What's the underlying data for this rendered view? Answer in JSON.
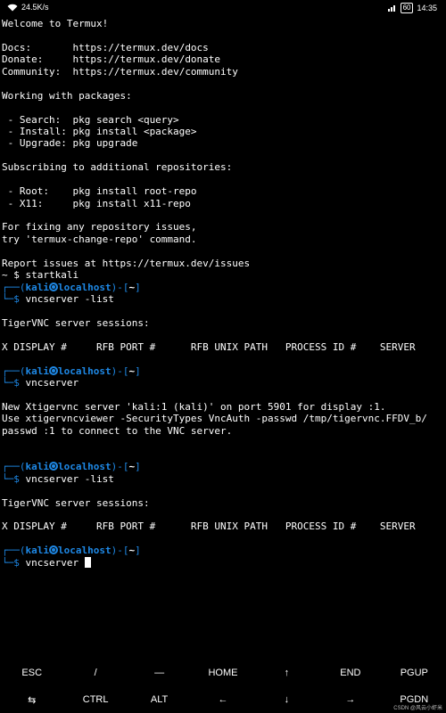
{
  "status_bar": {
    "speed": "24.5K/s",
    "battery": "60",
    "time": "14:35"
  },
  "terminal": {
    "welcome": "Welcome to Termux!",
    "docs_label": "Docs:",
    "docs_url": "https://termux.dev/docs",
    "donate_label": "Donate:",
    "donate_url": "https://termux.dev/donate",
    "community_label": "Community:",
    "community_url": "https://termux.dev/community",
    "packages_heading": "Working with packages:",
    "pkg_search": " - Search:  pkg search <query>",
    "pkg_install": " - Install: pkg install <package>",
    "pkg_upgrade": " - Upgrade: pkg upgrade",
    "repos_heading": "Subscribing to additional repositories:",
    "repo_root": " - Root:    pkg install root-repo",
    "repo_x11": " - X11:     pkg install x11-repo",
    "fix_repo_1": "For fixing any repository issues,",
    "fix_repo_2": "try 'termux-change-repo' command.",
    "report": "Report issues at https://termux.dev/issues",
    "startkali_cmd": "~ $ startkali",
    "prompt_top_start": "┌──(",
    "prompt_user": "kali",
    "prompt_host": "localhost",
    "prompt_close": ")-[",
    "prompt_path": "~",
    "prompt_end": "]",
    "prompt_bottom": "└─$ ",
    "cmd_list": "vncserver -list",
    "cmd_vnc": "vncserver",
    "sessions_heading": "TigerVNC server sessions:",
    "table_header": "X DISPLAY #     RFB PORT #      RFB UNIX PATH   PROCESS ID #    SERVER",
    "new_server": "New Xtigervnc server 'kali:1 (kali)' on port 5901 for display :1.",
    "use_viewer": "Use xtigervncviewer -SecurityTypes VncAuth -passwd /tmp/tigervnc.FFDV_b/",
    "passwd_line": "passwd :1 to connect to the VNC server."
  },
  "extra_keys": {
    "row1": [
      "ESC",
      "/",
      "—",
      "HOME",
      "↑",
      "END",
      "PGUP"
    ],
    "row2": [
      "⇆",
      "CTRL",
      "ALT",
      "←",
      "↓",
      "→",
      "PGDN"
    ]
  },
  "watermark": "CSDN @风云小虾米"
}
